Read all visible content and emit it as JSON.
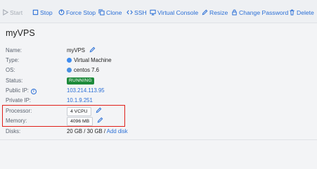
{
  "toolbar": {
    "start": "Start",
    "stop": "Stop",
    "force_stop": "Force Stop",
    "clone": "Clone",
    "ssh": "SSH",
    "virtual_console": "Virtual Console",
    "resize": "Resize",
    "change_password": "Change Password",
    "delete": "Delete"
  },
  "page_title": "myVPS",
  "details": {
    "name": {
      "label": "Name:",
      "value": "myVPS"
    },
    "type": {
      "label": "Type:",
      "value": "Virtual Machine"
    },
    "os": {
      "label": "OS:",
      "value": "centos 7.6"
    },
    "status": {
      "label": "Status:",
      "value": "RUNNING"
    },
    "public_ip": {
      "label": "Public IP:",
      "value": "103.214.113.95"
    },
    "private_ip": {
      "label": "Private IP:",
      "value": "10.1.9.251"
    },
    "processor": {
      "label": "Processor:",
      "value": "4 VCPU"
    },
    "memory": {
      "label": "Memory:",
      "value": "4096 MB"
    },
    "disks": {
      "label": "Disks:",
      "value": "20 GB / 30 GB /",
      "add_disk": "Add disk"
    }
  },
  "colors": {
    "accent": "#2b6fd6",
    "status_running": "#1d8a3a",
    "highlight": "#e0201a"
  },
  "icons": [
    "play-icon",
    "stop-icon",
    "force-stop-icon",
    "clone-icon",
    "code-icon",
    "monitor-icon",
    "edit-icon",
    "lock-icon",
    "trash-icon",
    "pencil-icon",
    "info-icon"
  ]
}
